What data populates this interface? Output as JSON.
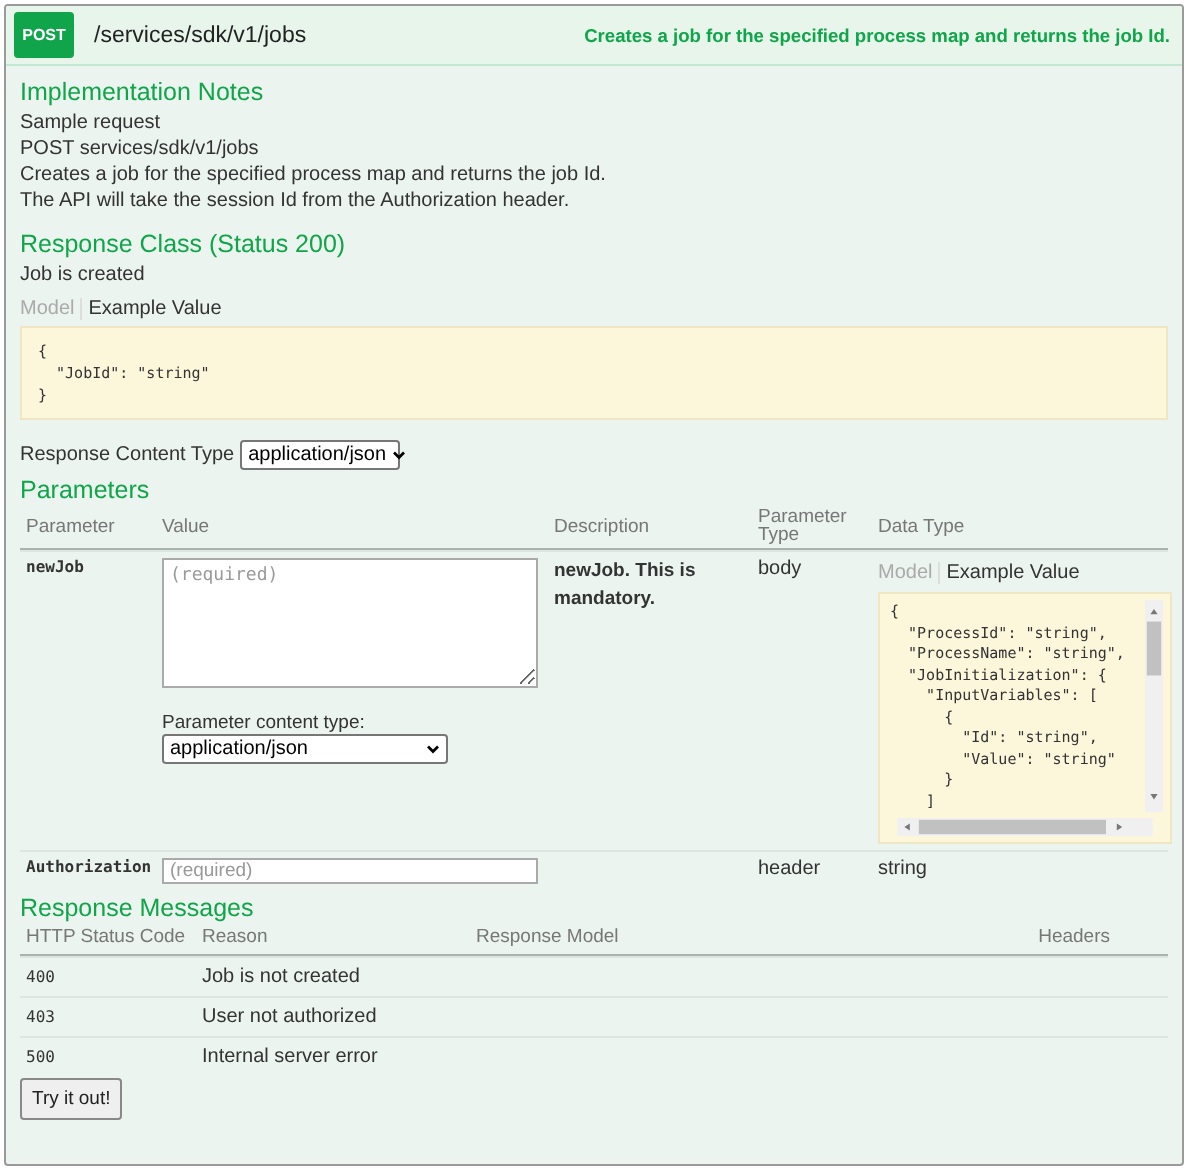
{
  "endpoint": {
    "method": "POST",
    "path": "/services/sdk/v1/jobs",
    "summary": "Creates a job for the specified process map and returns the job Id."
  },
  "implementation_notes": {
    "heading": "Implementation Notes",
    "lines": [
      "Sample request",
      "POST services/sdk/v1/jobs",
      "Creates a job for the specified process map and returns the job Id.",
      "The API will take the session Id from the Authorization header."
    ]
  },
  "response_class": {
    "heading": "Response Class (Status 200)",
    "description": "Job is created",
    "tabs": [
      {
        "label": "Model",
        "selected": false
      },
      {
        "label": "Example Value",
        "selected": true
      }
    ],
    "example": [
      "{",
      "  \"JobId\": \"string\"",
      "}"
    ]
  },
  "response_content_type": {
    "label": "Response Content Type",
    "value": "application/json"
  },
  "parameters": {
    "heading": "Parameters",
    "columns": [
      "Parameter",
      "Value",
      "Description",
      "Parameter Type",
      "Data Type"
    ],
    "rows": [
      {
        "kind": "textarea",
        "name": "newJob",
        "placeholder": "(required)",
        "content_type_label": "Parameter content type:",
        "content_type_value": "application/json",
        "description": "newJob. This is mandatory.",
        "param_type": "body",
        "data_type": {
          "kind": "model",
          "tabs": [
            {
              "label": "Model",
              "selected": false
            },
            {
              "label": "Example Value",
              "selected": true
            }
          ],
          "example": [
            "{",
            "  \"ProcessId\": \"string\",",
            "  \"ProcessName\": \"string\",",
            "  \"JobInitialization\": {",
            "    \"InputVariables\": [",
            "      {",
            "        \"Id\": \"string\",",
            "        \"Value\": \"string\"",
            "      }",
            "    ]"
          ]
        }
      },
      {
        "kind": "input",
        "name": "Authorization",
        "placeholder": "(required)",
        "param_type": "header",
        "data_type": {
          "kind": "text",
          "text": "string"
        }
      }
    ]
  },
  "response_messages": {
    "heading": "Response Messages",
    "columns": [
      "HTTP Status Code",
      "Reason",
      "Response Model",
      "Headers"
    ],
    "rows": [
      {
        "code": "400",
        "reason": "Job is not created"
      },
      {
        "code": "403",
        "reason": "User not authorized"
      },
      {
        "code": "500",
        "reason": "Internal server error"
      }
    ]
  },
  "submit_button": "Try it out!"
}
